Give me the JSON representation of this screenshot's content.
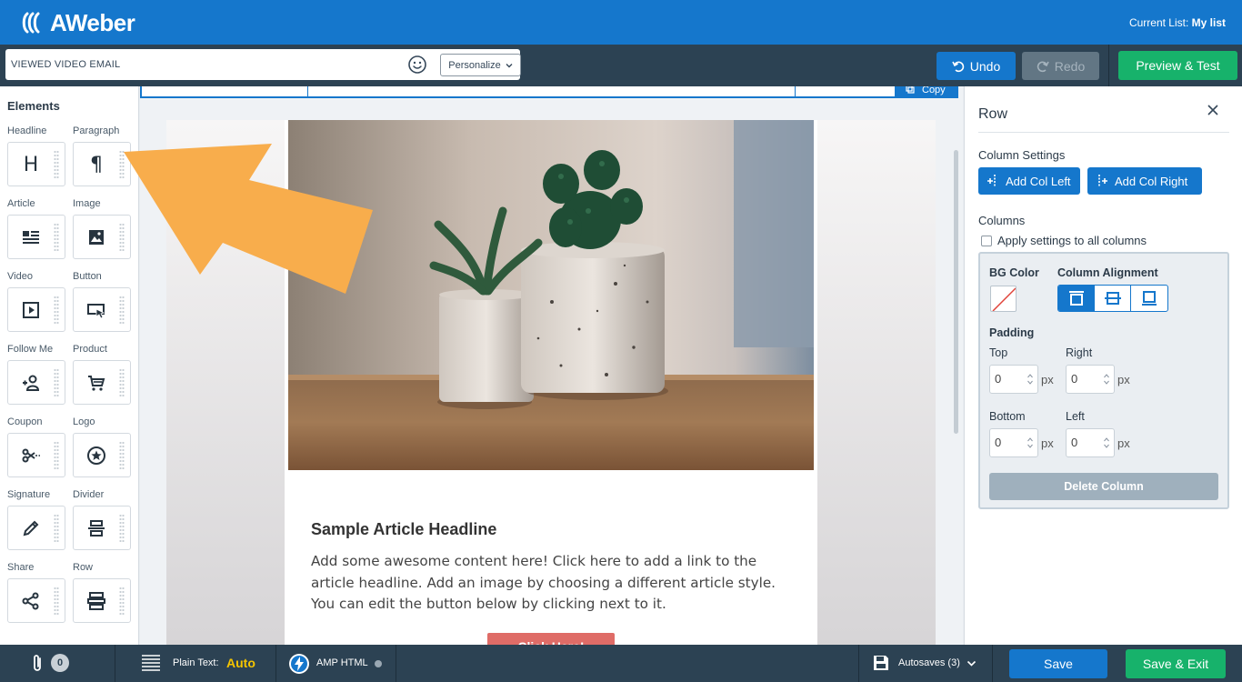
{
  "header": {
    "logo_text": "AWeber",
    "current_list_label": "Current List:",
    "current_list_value": "My list"
  },
  "subject": {
    "value": "VIEWED VIDEO EMAIL",
    "personalize_label": "Personalize",
    "undo_label": "Undo",
    "redo_label": "Redo",
    "preview_label": "Preview & Test"
  },
  "elements": {
    "title": "Elements",
    "items": [
      {
        "label": "Headline",
        "icon": "headline-icon"
      },
      {
        "label": "Paragraph",
        "icon": "paragraph-icon"
      },
      {
        "label": "Article",
        "icon": "article-icon"
      },
      {
        "label": "Image",
        "icon": "image-icon"
      },
      {
        "label": "Video",
        "icon": "video-icon"
      },
      {
        "label": "Button",
        "icon": "button-icon"
      },
      {
        "label": "Follow Me",
        "icon": "follow-me-icon"
      },
      {
        "label": "Product",
        "icon": "cart-icon"
      },
      {
        "label": "Coupon",
        "icon": "scissors-icon"
      },
      {
        "label": "Logo",
        "icon": "star-icon"
      },
      {
        "label": "Signature",
        "icon": "pen-icon"
      },
      {
        "label": "Divider",
        "icon": "divider-icon"
      },
      {
        "label": "Share",
        "icon": "share-icon"
      },
      {
        "label": "Row",
        "icon": "row-icon"
      }
    ]
  },
  "canvas": {
    "copy_label": "Copy",
    "headline": "Sample Article Headline",
    "article_text": "Add some awesome content here! Click here to add a link to the article headline. Add an image by choosing a different article style. You can edit the button below by clicking next to it.",
    "button_label": "Click Here!"
  },
  "row_panel": {
    "title": "Row",
    "column_settings_label": "Column Settings",
    "add_col_left": "Add Col Left",
    "add_col_right": "Add Col Right",
    "columns_label": "Columns",
    "apply_all_label": "Apply settings to all columns",
    "bg_color_label": "BG Color",
    "alignment_label": "Column Alignment",
    "padding_label": "Padding",
    "top_label": "Top",
    "right_label": "Right",
    "bottom_label": "Bottom",
    "left_label": "Left",
    "top_value": "0",
    "right_value": "0",
    "bottom_value": "0",
    "left_value": "0",
    "unit": "px",
    "delete_label": "Delete Column"
  },
  "footer": {
    "attachments_count": "0",
    "plain_text_label": "Plain Text:",
    "plain_text_value": "Auto",
    "amp_label": "AMP HTML",
    "autosaves_label": "Autosaves (3)",
    "save_label": "Save",
    "save_exit_label": "Save & Exit"
  },
  "colors": {
    "brand_blue": "#1577cc",
    "dark_bar": "#2c4253",
    "green": "#17b26b",
    "arrow_orange": "#f8ad4c",
    "cta_red": "#df6c67"
  }
}
